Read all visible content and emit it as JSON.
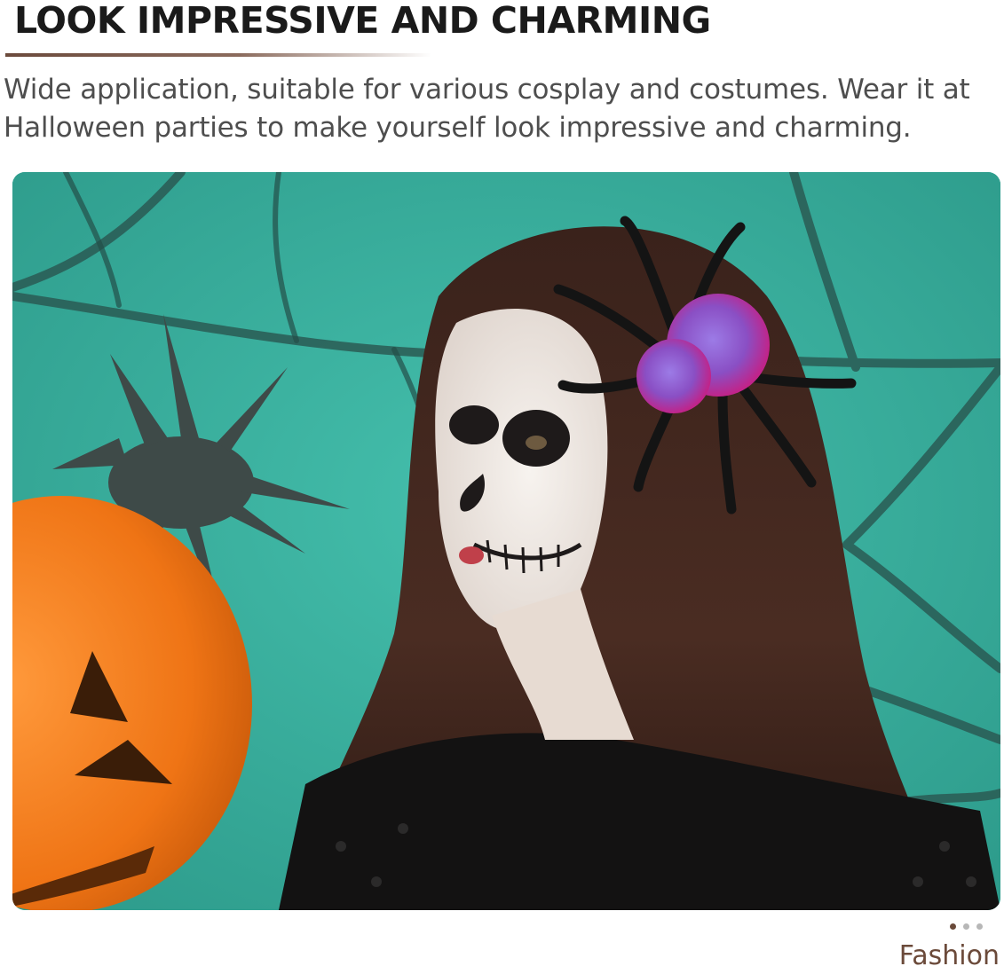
{
  "header": {
    "title": "LOOK IMPRESSIVE AND CHARMING"
  },
  "description": "Wide application, suitable for various cosplay and costumes. Wear it at Halloween parties to make yourself look impressive and charming.",
  "photo": {
    "subject": "woman-with-skull-makeup-and-spider-hair-clip"
  },
  "carousel": {
    "dot_count": 3,
    "active_index": 0
  },
  "caption": "Fashion",
  "colors": {
    "background_teal": "#38ad9c",
    "accent_brown": "#6b4a3a",
    "pumpkin_orange": "#f07a1c"
  }
}
